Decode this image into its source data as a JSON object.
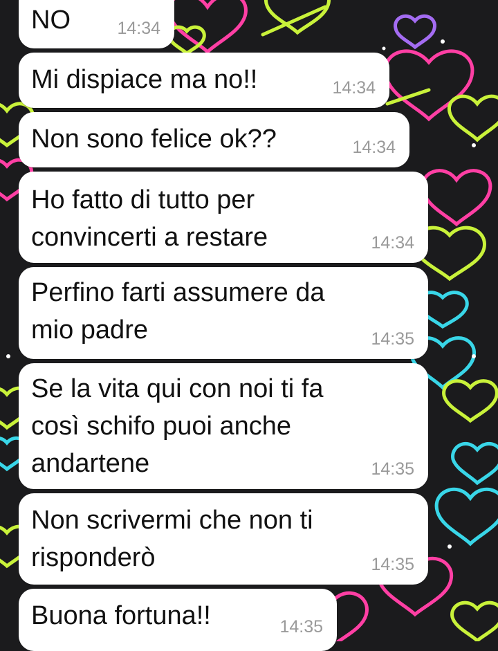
{
  "chat": {
    "messages": [
      {
        "text": "NO",
        "time": "14:34"
      },
      {
        "text": "Mi dispiace ma no!!",
        "time": "14:34"
      },
      {
        "text": "Non sono felice ok??",
        "time": "14:34"
      },
      {
        "text": "Ho fatto di tutto per\nconvincerti a restare",
        "time": "14:34"
      },
      {
        "text": "Perfino farti assumere da\nmio padre",
        "time": "14:35"
      },
      {
        "text": "Se la vita qui con noi ti fa\ncosì schifo puoi anche\nandartene",
        "time": "14:35"
      },
      {
        "text": "Non scrivermi che non ti\nrisponderò",
        "time": "14:35"
      },
      {
        "text": "Buona fortuna!!",
        "time": "14:35"
      }
    ]
  },
  "wallpaper": {
    "theme": "neon-hearts-doodle",
    "colors": [
      "#ff3fa4",
      "#c9f23a",
      "#39d6e8",
      "#a46cf2",
      "#ffffff"
    ]
  }
}
